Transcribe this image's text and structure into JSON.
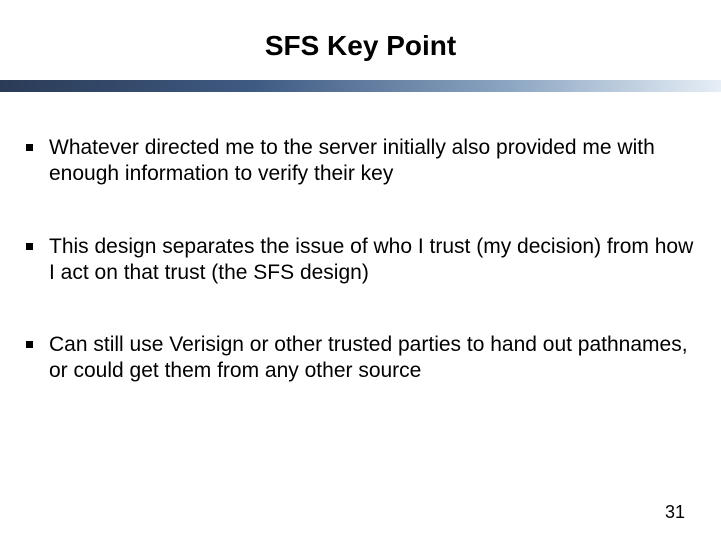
{
  "slide": {
    "title": "SFS Key Point",
    "bullets": [
      {
        "text": "Whatever directed me to the server initially also provided me with enough information to verify their key"
      },
      {
        "text": "This design separates the issue of who I trust (my decision) from how I act on that trust (the SFS design)"
      },
      {
        "text": "Can still use Verisign or other trusted parties to hand out pathnames, or could get them from any other source"
      }
    ],
    "page_number": "31"
  }
}
